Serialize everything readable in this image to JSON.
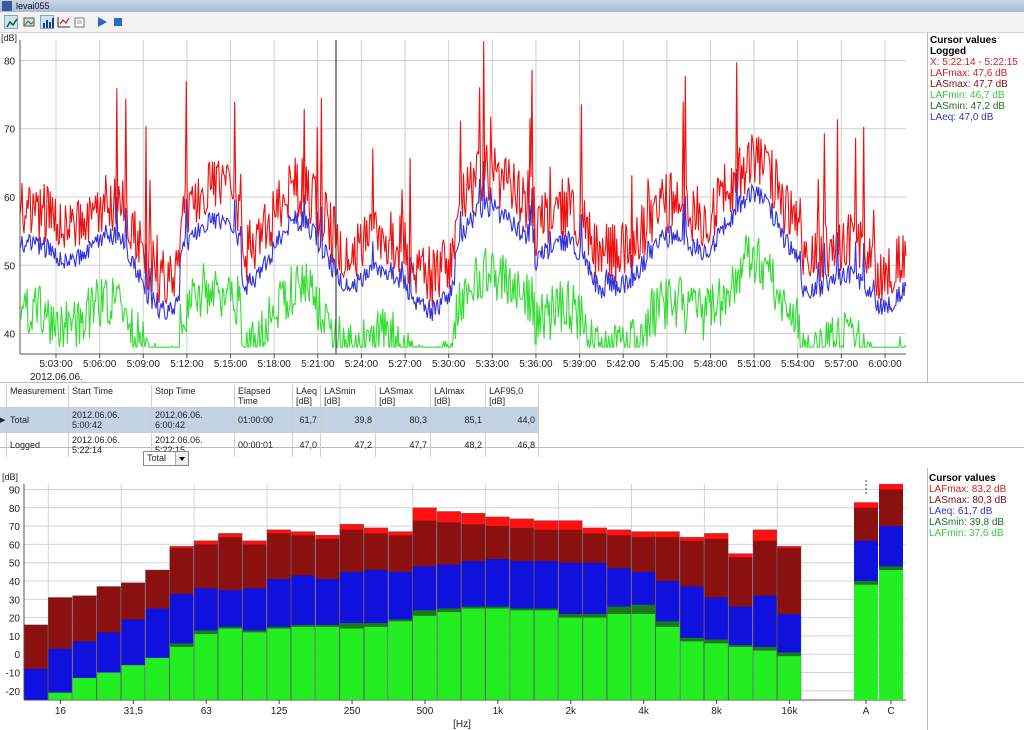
{
  "window": {
    "title": "levai055"
  },
  "toolbar": {
    "tools": [
      {
        "name": "line-chart-tool-icon",
        "selected": true
      },
      {
        "name": "image-tool-icon",
        "selected": false
      },
      {
        "name": "bar-chart-tool-icon",
        "selected": true
      },
      {
        "name": "scatter-tool-icon",
        "selected": false
      },
      {
        "name": "copy-tool-icon",
        "selected": false
      },
      {
        "name": "play-icon",
        "selected": false
      },
      {
        "name": "stop-icon",
        "selected": false
      }
    ]
  },
  "top_cursor": {
    "heading": "Cursor values",
    "subheading": "Logged",
    "lines": [
      {
        "text": "X: 5:22:14 - 5:22:15",
        "color": "#cc2222"
      },
      {
        "text": "LAFmax: 47,6 dB",
        "color": "#cc2222"
      },
      {
        "text": "LASmax: 47,7 dB",
        "color": "#7a1010"
      },
      {
        "text": "LAFmin: 46,7 dB",
        "color": "#33cc33"
      },
      {
        "text": "LASmin: 47,2 dB",
        "color": "#1e6e1e"
      },
      {
        "text": "LAeq: 47,0 dB",
        "color": "#3333cc"
      }
    ]
  },
  "bottom_cursor": {
    "heading": "Cursor values",
    "lines": [
      {
        "text": "LAFmax: 83,2 dB",
        "color": "#cc2222"
      },
      {
        "text": "LASmax: 80,3 dB",
        "color": "#7a1010"
      },
      {
        "text": "LAeq: 61,7 dB",
        "color": "#3333cc"
      },
      {
        "text": "LASmin: 39,8 dB",
        "color": "#1e6e1e"
      },
      {
        "text": "LAFmin: 37,6 dB",
        "color": "#33cc33"
      }
    ]
  },
  "table": {
    "columns": [
      "Measurement",
      "Start Time",
      "Stop Time",
      "Elapsed Time",
      "LAeq\n[dB]",
      "LASmin\n[dB]",
      "LASmax\n[dB]",
      "LAImax\n[dB]",
      "LAF95,0\n[dB]"
    ],
    "rows": [
      [
        "Total",
        "2012.06.06. 5:00:42",
        "2012.06.06. 6:00:42",
        "01:00:00",
        "61,7",
        "39,8",
        "80,3",
        "85,1",
        "44,0"
      ],
      [
        "Logged",
        "2012.06.06. 5:22:14",
        "2012.06.06. 5:22:15",
        "00:00:01",
        "47,0",
        "47,2",
        "47,7",
        "48,2",
        "46,8"
      ]
    ]
  },
  "dropdown": {
    "value": "Total"
  },
  "chart_data": [
    {
      "type": "line",
      "unit_label": "[dB]",
      "ylim": [
        37,
        83
      ],
      "yticks": [
        40,
        50,
        60,
        70,
        80
      ],
      "xticks": [
        "5:03:00",
        "5:06:00",
        "5:09:00",
        "5:12:00",
        "5:15:00",
        "5:18:00",
        "5:21:00",
        "5:24:00",
        "5:27:00",
        "5:30:00",
        "5:33:00",
        "5:36:00",
        "5:39:00",
        "5:42:00",
        "5:45:00",
        "5:48:00",
        "5:51:00",
        "5:54:00",
        "5:57:00",
        "6:00:00"
      ],
      "date_label": "2012.06.06.",
      "cursor_x": "5:22:14",
      "series_colors": {
        "LAFmax": "#ee1111",
        "LASmax": "#a01010",
        "LAeq": "#3333dd",
        "LAFmin": "#33dd33",
        "LASmin": "#1e7e1e"
      },
      "series": [
        {
          "name": "LAFmax",
          "color": "#ee1111"
        },
        {
          "name": "LAeq",
          "color": "#3333dd"
        },
        {
          "name": "LAFmin",
          "color": "#33dd33"
        }
      ]
    },
    {
      "type": "bar",
      "unit_label": "[dB]",
      "xlabel": "[Hz]",
      "ylim": [
        -25,
        93
      ],
      "yticks": [
        -20,
        -10,
        0,
        10,
        20,
        30,
        40,
        50,
        60,
        70,
        80,
        90
      ],
      "categories": [
        "12,5",
        "16",
        "20",
        "25",
        "31,5",
        "40",
        "50",
        "63",
        "80",
        "100",
        "125",
        "160",
        "200",
        "250",
        "315",
        "400",
        "500",
        "630",
        "800",
        "1k",
        "1.25k",
        "1.6k",
        "2k",
        "2.5k",
        "3.15k",
        "4k",
        "5k",
        "6.3k",
        "8k",
        "10k",
        "12.5k",
        "16k",
        "20k"
      ],
      "xtick_labels": {
        "16": "16",
        "31,5": "31,5",
        "63": "63",
        "125": "125",
        "250": "250",
        "500": "500",
        "1k": "1k",
        "2k": "2k",
        "4k": "4k",
        "8k": "8k",
        "16k": "16k"
      },
      "series": [
        {
          "name": "LAFmax",
          "color": "#ff1111",
          "values": [
            16,
            31,
            32,
            37,
            39,
            46,
            59,
            62,
            66,
            62,
            68,
            67,
            65,
            71,
            69,
            67,
            80,
            78,
            77,
            75,
            74,
            73,
            73,
            69,
            68,
            67,
            67,
            64,
            66,
            55,
            68,
            59
          ]
        },
        {
          "name": "LASmax",
          "color": "#8b1010",
          "values": [
            16,
            31,
            32,
            37,
            39,
            46,
            58,
            60,
            64,
            60,
            66,
            65,
            63,
            68,
            66,
            65,
            73,
            72,
            71,
            70,
            69,
            68,
            68,
            66,
            65,
            64,
            64,
            62,
            63,
            53,
            62,
            58
          ]
        },
        {
          "name": "LAeq",
          "color": "#1111dd",
          "values": [
            -8,
            3,
            7,
            12,
            19,
            25,
            33,
            36,
            35,
            36,
            41,
            43,
            41,
            45,
            46,
            45,
            48,
            49,
            51,
            52,
            51,
            51,
            50,
            50,
            47,
            45,
            40,
            37,
            31,
            26,
            32,
            22
          ]
        },
        {
          "name": "LASmin",
          "color": "#1a7a1a",
          "values": [
            -25,
            -21,
            -13,
            -10,
            -6,
            -2,
            6,
            13,
            15,
            13,
            15,
            16,
            16,
            17,
            17,
            19,
            24,
            25,
            26,
            26,
            25,
            25,
            22,
            22,
            26,
            27,
            18,
            9,
            8,
            5,
            4,
            1
          ]
        },
        {
          "name": "LAFmin",
          "color": "#22ee22",
          "values": [
            -25,
            -21,
            -13,
            -10,
            -6,
            -2,
            4,
            11,
            14,
            12,
            14,
            15,
            15,
            14,
            15,
            18,
            21,
            23,
            25,
            25,
            24,
            24,
            20,
            20,
            22,
            22,
            15,
            7,
            6,
            4,
            2,
            -1
          ]
        }
      ],
      "single_bars": [
        {
          "label": "A",
          "LAFmax": 83,
          "LASmax": 80,
          "LAeq": 62,
          "LASmin": 40,
          "LAFmin": 38
        },
        {
          "label": "C",
          "LAFmax": 93,
          "LASmax": 90,
          "LAeq": 70,
          "LASmin": 48,
          "LAFmin": 46
        }
      ]
    }
  ]
}
